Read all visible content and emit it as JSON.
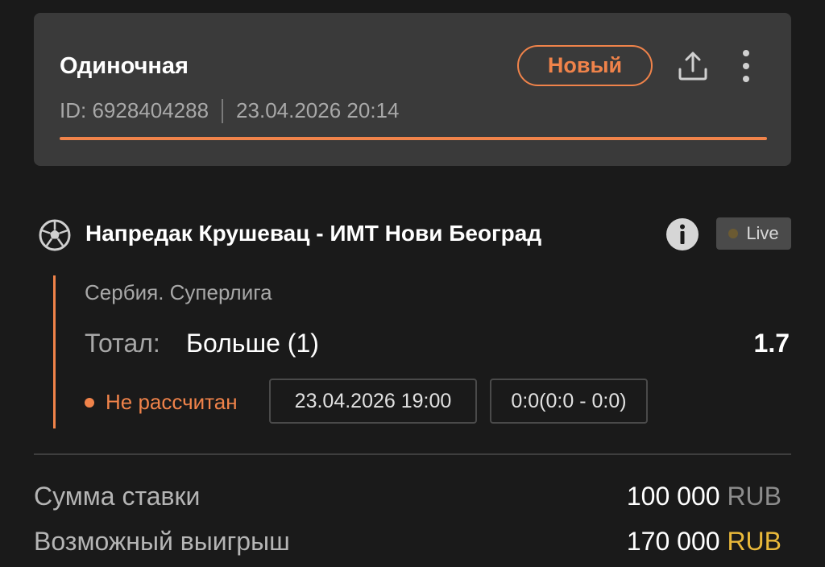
{
  "header": {
    "bet_type": "Одиночная",
    "id_text": "ID: 6928404288",
    "datetime": "23.04.2026 20:14",
    "status_label": "Новый",
    "share_icon": "share-icon",
    "more_icon": "more-vertical-icon",
    "accent_color": "#f0834a"
  },
  "event": {
    "sport_icon": "soccer-ball-icon",
    "name": "Напредак Крушевац - ИМТ Нови Београд",
    "info_icon": "info-icon",
    "live_label": "Live",
    "league": "Сербия. Суперлига",
    "market_label": "Тотал:",
    "market_value": "Больше (1)",
    "odds": "1.7",
    "settle_status": "Не рассчитан",
    "event_datetime": "23.04.2026 19:00",
    "score": "0:0(0:0 - 0:0)"
  },
  "summary": {
    "stake_label": "Сумма ставки",
    "stake_amount": "100 000",
    "stake_currency": "RUB",
    "win_label": "Возможный выигрыш",
    "win_amount": "170 000",
    "win_currency": "RUB",
    "win_currency_color": "#e9b93a"
  }
}
